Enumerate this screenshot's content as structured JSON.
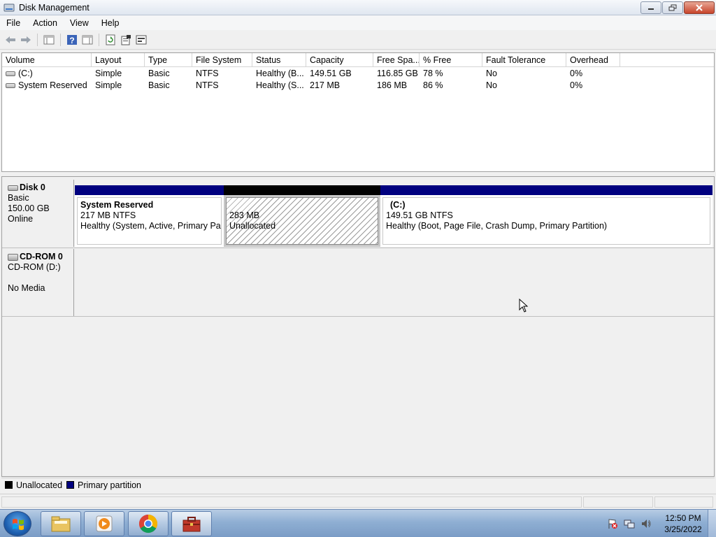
{
  "window": {
    "title": "Disk Management"
  },
  "menu": [
    "File",
    "Action",
    "View",
    "Help"
  ],
  "volume_list": {
    "columns": [
      "Volume",
      "Layout",
      "Type",
      "File System",
      "Status",
      "Capacity",
      "Free Spa...",
      "% Free",
      "Fault Tolerance",
      "Overhead"
    ],
    "rows": [
      [
        "(C:)",
        "Simple",
        "Basic",
        "NTFS",
        "Healthy (B...",
        "149.51 GB",
        "116.85 GB",
        "78 %",
        "No",
        "0%"
      ],
      [
        "System Reserved",
        "Simple",
        "Basic",
        "NTFS",
        "Healthy (S...",
        "217 MB",
        "186 MB",
        "86 %",
        "No",
        "0%"
      ]
    ]
  },
  "disks": [
    {
      "name": "Disk 0",
      "type": "Basic",
      "size": "150.00 GB",
      "state": "Online",
      "partitions": [
        {
          "kind": "primary",
          "name": "System Reserved",
          "size_fs": "217 MB NTFS",
          "status": "Healthy (System, Active, Primary Parti"
        },
        {
          "kind": "unallocated",
          "size": "283 MB",
          "label": "Unallocated"
        },
        {
          "kind": "primary",
          "name": "(C:)",
          "size_fs": "149.51 GB NTFS",
          "status": "Healthy (Boot, Page File, Crash Dump, Primary Partition)"
        }
      ]
    },
    {
      "name": "CD-ROM 0",
      "type": "CD-ROM (D:)",
      "state": "No Media"
    }
  ],
  "legend": [
    {
      "label": "Unallocated",
      "color": "#000000"
    },
    {
      "label": "Primary partition",
      "color": "#00007f"
    }
  ],
  "taskbar": {
    "apps": [
      "explorer-icon",
      "media-player-icon",
      "chrome-icon",
      "toolbox-icon"
    ],
    "clock": {
      "time": "12:50 PM",
      "date": "3/25/2022"
    }
  }
}
